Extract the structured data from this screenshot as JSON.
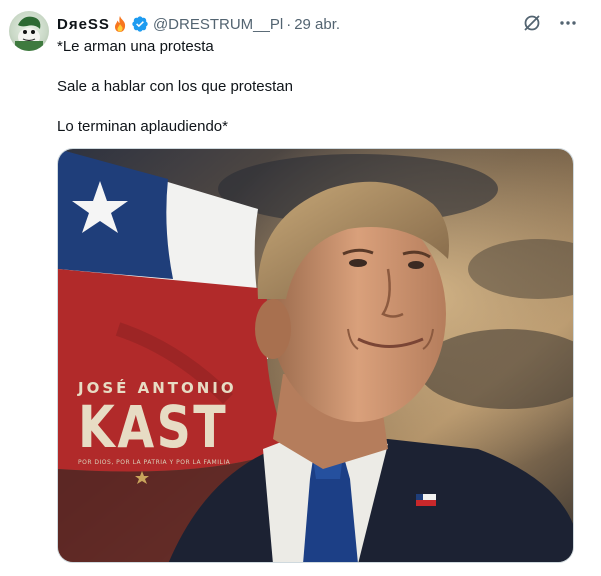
{
  "tweet": {
    "display_name": "DяeSS",
    "handle": "@DRESTRUM__Pl",
    "separator": "·",
    "date": "29 abr.",
    "icons": [
      "fire-emoji",
      "verified-badge",
      "grok-icon",
      "more-icon"
    ],
    "lines": [
      "*Le arman una protesta",
      "Sale a hablar con los que protestan",
      "Lo terminan aplaudiendo*"
    ]
  },
  "media": {
    "name_line1": "JOSÉ ANTONIO",
    "name_line2": "KAST",
    "slogan": "POR DIOS, POR LA PATRIA Y POR LA FAMILIA",
    "colors": {
      "flag_red": "#b12a2a",
      "flag_blue": "#1f3e7a",
      "sky": "#7a6248",
      "suit": "#1c2233",
      "tie": "#1c3f86",
      "text": "#e7dcc4"
    }
  }
}
